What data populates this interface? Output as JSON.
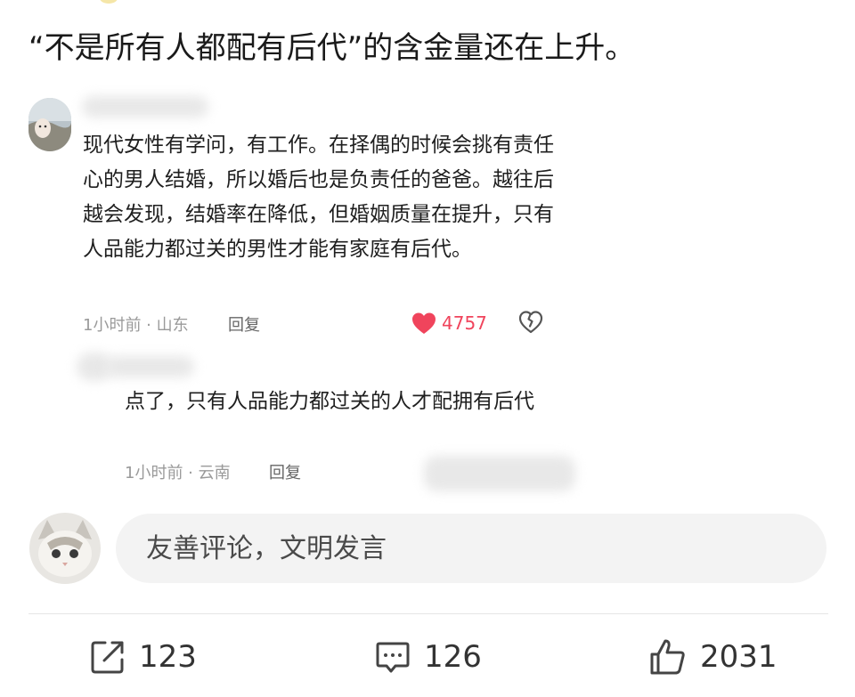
{
  "post": {
    "headline": "“不是所有人都配有后代”的含金量还在上升。"
  },
  "comment": {
    "text": "现代女性有学问，有工作。在择偶的时候会挑有责任心的男人结婚，所以婚后也是负责任的爸爸。越往后越会发现，结婚率在降低，但婚姻质量在提升，只有人品能力都过关的男性才能有家庭有后代。",
    "time": "1小时前",
    "location": "山东",
    "reply_label": "回复",
    "likes": "4757"
  },
  "reply": {
    "text": "点了，只有人品能力都过关的人才配拥有后代",
    "time": "1小时前",
    "location": "云南",
    "reply_label": "回复"
  },
  "composer": {
    "placeholder": "友善评论，文明发言"
  },
  "actions": {
    "share_count": "123",
    "comment_count": "126",
    "like_count": "2031"
  },
  "colors": {
    "like_red": "#f0445c",
    "meta_gray": "#9a9a9a",
    "input_bg": "#f3f3f3"
  },
  "icons": [
    "share-icon",
    "comment-icon",
    "thumbs-up-icon",
    "heart-icon",
    "broken-heart-icon"
  ]
}
